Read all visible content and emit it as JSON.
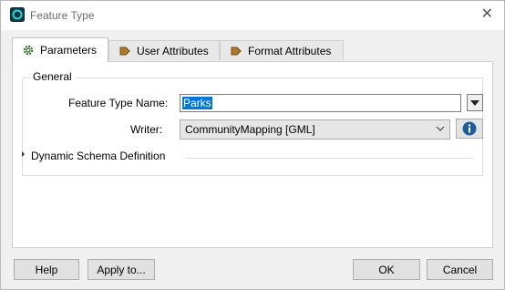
{
  "window": {
    "title": "Feature Type",
    "close_glyph": "✕"
  },
  "tabs": [
    {
      "label": "Parameters",
      "icon": "gear-icon",
      "active": true
    },
    {
      "label": "User Attributes",
      "icon": "arrow-tag-icon",
      "active": false
    },
    {
      "label": "Format Attributes",
      "icon": "arrow-tag-icon",
      "active": false
    }
  ],
  "general": {
    "legend": "General",
    "feature_type_name_label": "Feature Type Name:",
    "feature_type_name_value": "Parks",
    "writer_label": "Writer:",
    "writer_value": "CommunityMapping [GML]",
    "dynamic_schema_label": "Dynamic Schema Definition"
  },
  "buttons": {
    "help": "Help",
    "apply": "Apply to...",
    "ok": "OK",
    "cancel": "Cancel"
  },
  "colors": {
    "selection": "#0078d7",
    "info": "#1f5d99",
    "tab_icon": "#b07a2a"
  }
}
